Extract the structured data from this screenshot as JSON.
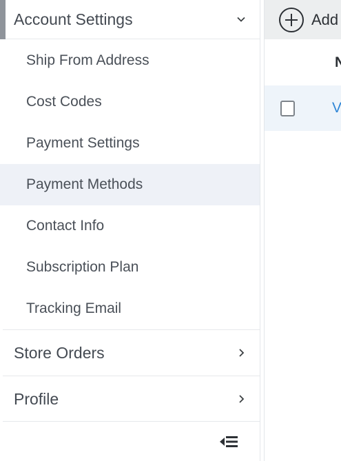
{
  "sidebar": {
    "account_settings": {
      "label": "Account Settings",
      "items": [
        {
          "label": "Ship From Address"
        },
        {
          "label": "Cost Codes"
        },
        {
          "label": "Payment Settings"
        },
        {
          "label": "Payment Methods",
          "selected": true
        },
        {
          "label": "Contact Info"
        },
        {
          "label": "Subscription Plan"
        },
        {
          "label": "Tracking Email"
        }
      ]
    },
    "store_orders": {
      "label": "Store Orders"
    },
    "profile": {
      "label": "Profile"
    },
    "icons": {
      "expanded": "chevron-down-icon",
      "collapsed": "chevron-right-icon",
      "collapse_sidebar": "collapse-sidebar-icon"
    }
  },
  "main": {
    "toolbar": {
      "add_label": "Add",
      "add_icon": "plus-circle-icon"
    },
    "table": {
      "header_first_letter": "N",
      "rows": [
        {
          "link_text": "V"
        }
      ]
    }
  },
  "colors": {
    "accent_link": "#2f86d6",
    "selected_bg": "#eef1f7",
    "toolbar_bg": "#eceeef",
    "active_marker": "#8f949b"
  }
}
